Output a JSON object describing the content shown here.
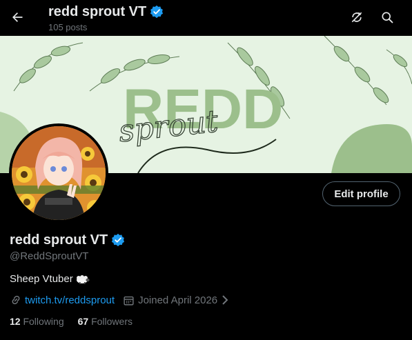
{
  "header": {
    "title": "redd sprout VT",
    "posts_count": "105 posts",
    "back_icon": "arrow-left-icon",
    "icons": [
      "no-sync-icon",
      "search-icon"
    ]
  },
  "banner": {
    "big_text": "REDD",
    "script_text": "sprout",
    "colors": {
      "background": "#e6f3e3",
      "leaf": "#7fa874",
      "text": "#9cbf8c",
      "script": "#2e3a2c"
    }
  },
  "profile": {
    "display_name": "redd sprout VT",
    "handle": "@ReddSproutVT",
    "bio": "Sheep Vtuber",
    "bio_emoji": "sheep",
    "link": "twitch.tv/reddsprout",
    "joined": "Joined April 2026",
    "edit_button": "Edit profile",
    "verified": true
  },
  "stats": {
    "following_count": "12",
    "following_label": "Following",
    "followers_count": "67",
    "followers_label": "Followers"
  },
  "colors": {
    "accent": "#1d9bf0",
    "muted": "#71767b",
    "text": "#e7e9ea",
    "bg": "#000000"
  }
}
